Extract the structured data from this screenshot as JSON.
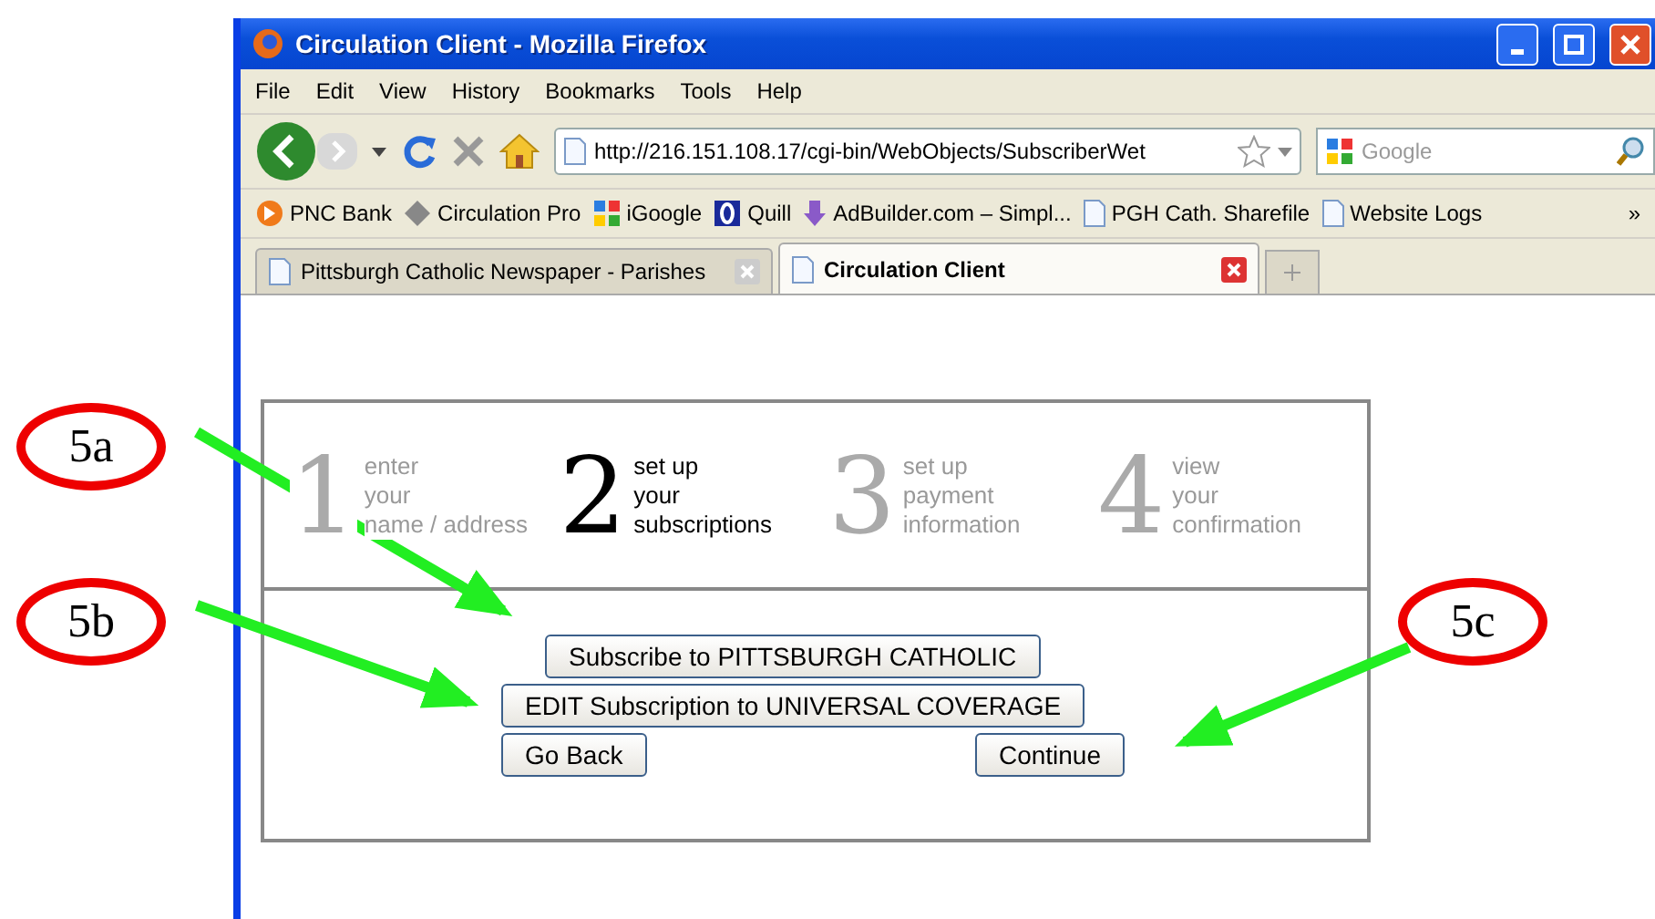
{
  "window": {
    "title": "Circulation Client - Mozilla Firefox"
  },
  "menu": [
    "File",
    "Edit",
    "View",
    "History",
    "Bookmarks",
    "Tools",
    "Help"
  ],
  "address": {
    "value": "http://216.151.108.17/cgi-bin/WebObjects/SubscriberWet"
  },
  "search": {
    "placeholder": "Google"
  },
  "bookmarks": [
    {
      "label": "PNC Bank",
      "kind": "pnc"
    },
    {
      "label": "Circulation Pro",
      "kind": "gem"
    },
    {
      "label": "iGoogle",
      "kind": "google"
    },
    {
      "label": "Quill",
      "kind": "quill"
    },
    {
      "label": "AdBuilder.com – Simpl...",
      "kind": "ad"
    },
    {
      "label": "PGH Cath. Sharefile",
      "kind": "page"
    },
    {
      "label": "Website Logs",
      "kind": "page"
    }
  ],
  "bookmarks_more": "»",
  "tabs": [
    {
      "label": "Pittsburgh Catholic Newspaper - Parishes",
      "selected": false
    },
    {
      "label": "Circulation Client",
      "selected": true
    }
  ],
  "steps": [
    {
      "number": "1",
      "lines": [
        "enter",
        "your",
        "name / address"
      ],
      "selected": false
    },
    {
      "number": "2",
      "lines": [
        "set up",
        "your",
        "subscriptions"
      ],
      "selected": true
    },
    {
      "number": "3",
      "lines": [
        "set up",
        "payment",
        "information"
      ],
      "selected": false
    },
    {
      "number": "4",
      "lines": [
        "view",
        "your",
        "confirmation"
      ],
      "selected": false
    }
  ],
  "buttons": {
    "subscribe": "Subscribe to PITTSBURGH CATHOLIC",
    "edit": "EDIT Subscription to UNIVERSAL COVERAGE",
    "back": "Go Back",
    "continue": "Continue"
  },
  "callouts": [
    {
      "label": "5a"
    },
    {
      "label": "5b"
    },
    {
      "label": "5c"
    }
  ]
}
